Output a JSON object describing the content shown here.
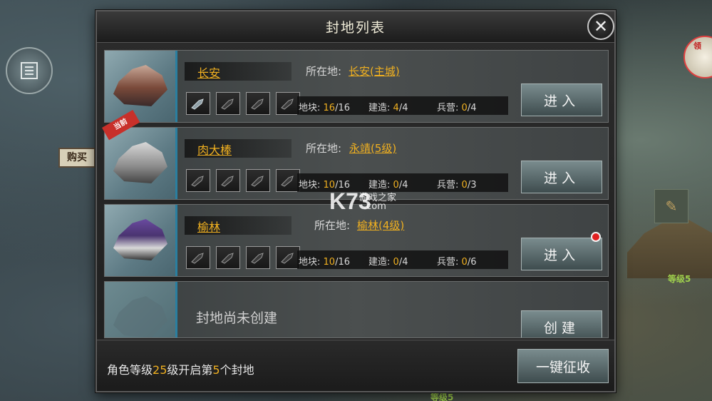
{
  "panel": {
    "title": "封地列表"
  },
  "background": {
    "buy_sign": "购买",
    "side_badge": "领",
    "level_label_right": "等级5",
    "level_label_bottom": "等级5"
  },
  "fiefs": [
    {
      "name": "长安",
      "location_label": "所在地:",
      "location": "长安(主城)",
      "is_current": false,
      "current_label": "",
      "plot_label": "地块:",
      "plot_value": "16",
      "plot_total": "/16",
      "build_label": "建造:",
      "build_value": "4",
      "build_total": "/4",
      "barracks_label": "兵营:",
      "barracks_value": "0",
      "barracks_total": "/4",
      "enter_label": "进入",
      "has_notification": false
    },
    {
      "name": "肉大棒",
      "location_label": "所在地:",
      "location": "永靖(5级)",
      "is_current": true,
      "current_label": "当前",
      "plot_label": "地块:",
      "plot_value": "10",
      "plot_total": "/16",
      "build_label": "建造:",
      "build_value": "0",
      "build_total": "/4",
      "barracks_label": "兵营:",
      "barracks_value": "0",
      "barracks_total": "/3",
      "enter_label": "进入",
      "has_notification": false
    },
    {
      "name": "榆林",
      "location_label": "所在地:",
      "location": "榆林(4级)",
      "is_current": false,
      "current_label": "",
      "plot_label": "地块:",
      "plot_value": "10",
      "plot_total": "/16",
      "build_label": "建造:",
      "build_value": "0",
      "build_total": "/4",
      "barracks_label": "兵营:",
      "barracks_value": "0",
      "barracks_total": "/6",
      "enter_label": "进入",
      "has_notification": true
    }
  ],
  "empty_slot": {
    "text": "封地尚未创建",
    "create_label": "创建"
  },
  "footer": {
    "text_prefix": "角色等级",
    "level": "25",
    "text_mid": "级开启第",
    "slot_number": "5",
    "text_suffix": "个封地",
    "collect_label": "一键征收"
  },
  "watermark": {
    "brand": "K73",
    "tagline": "游戏之家",
    "domain": ".com"
  },
  "colors": {
    "highlight": "#f0b020",
    "accent_border": "#2a7fa0",
    "notification": "#e02020"
  }
}
